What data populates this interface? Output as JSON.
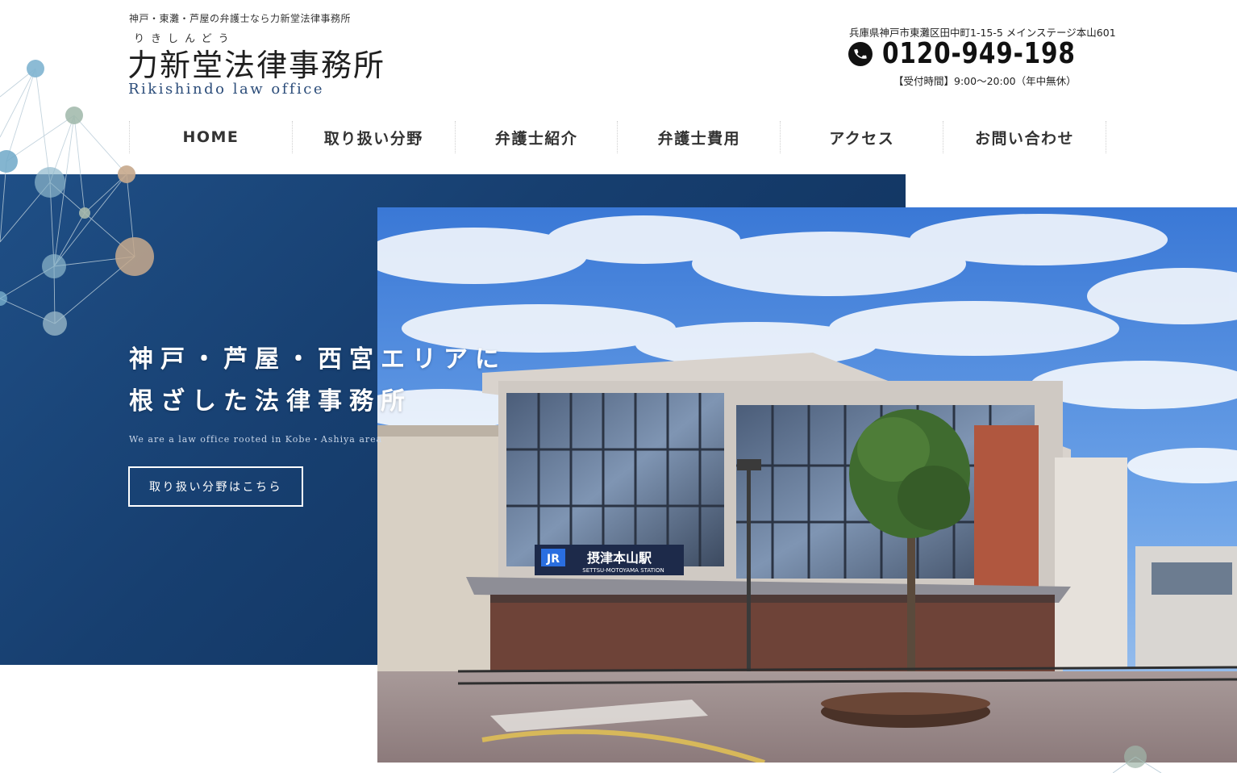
{
  "header": {
    "tagline": "神戸・東灘・芦屋の弁護士なら力新堂法律事務所",
    "logo_ruby": "りきしんどう",
    "logo_jp": "力新堂法律事務所",
    "logo_en": "Rikishindo law office",
    "address": "兵庫県神戸市東灘区田中町1-15-5 メインステージ本山601",
    "phone": "0120-949-198",
    "hours": "【受付時間】9:00〜20:00（年中無休）"
  },
  "nav": {
    "items": [
      {
        "label": "HOME"
      },
      {
        "label": "取り扱い分野"
      },
      {
        "label": "弁護士紹介"
      },
      {
        "label": "弁護士費用"
      },
      {
        "label": "アクセス"
      },
      {
        "label": "お問い合わせ"
      }
    ]
  },
  "hero": {
    "line1": "神戸・芦屋・西宮エリアに",
    "line2": "根ざした法律事務所",
    "subtitle": "We are a law office rooted in Kobe・Ashiya area",
    "button_label": "取り扱い分野はこちら",
    "station_sign": "摂津本山駅",
    "station_sign_en": "SETTSU-MOTOYAMA STATION",
    "jr_logo": "JR"
  },
  "colors": {
    "hero_blue": "#173f70",
    "brand_text": "#2c4d7a",
    "molecule_accent": "#c7a98c",
    "molecule_blue": "#7fb4d0"
  },
  "icons": {
    "phone": "phone-icon",
    "molecule": "molecule-decoration"
  }
}
